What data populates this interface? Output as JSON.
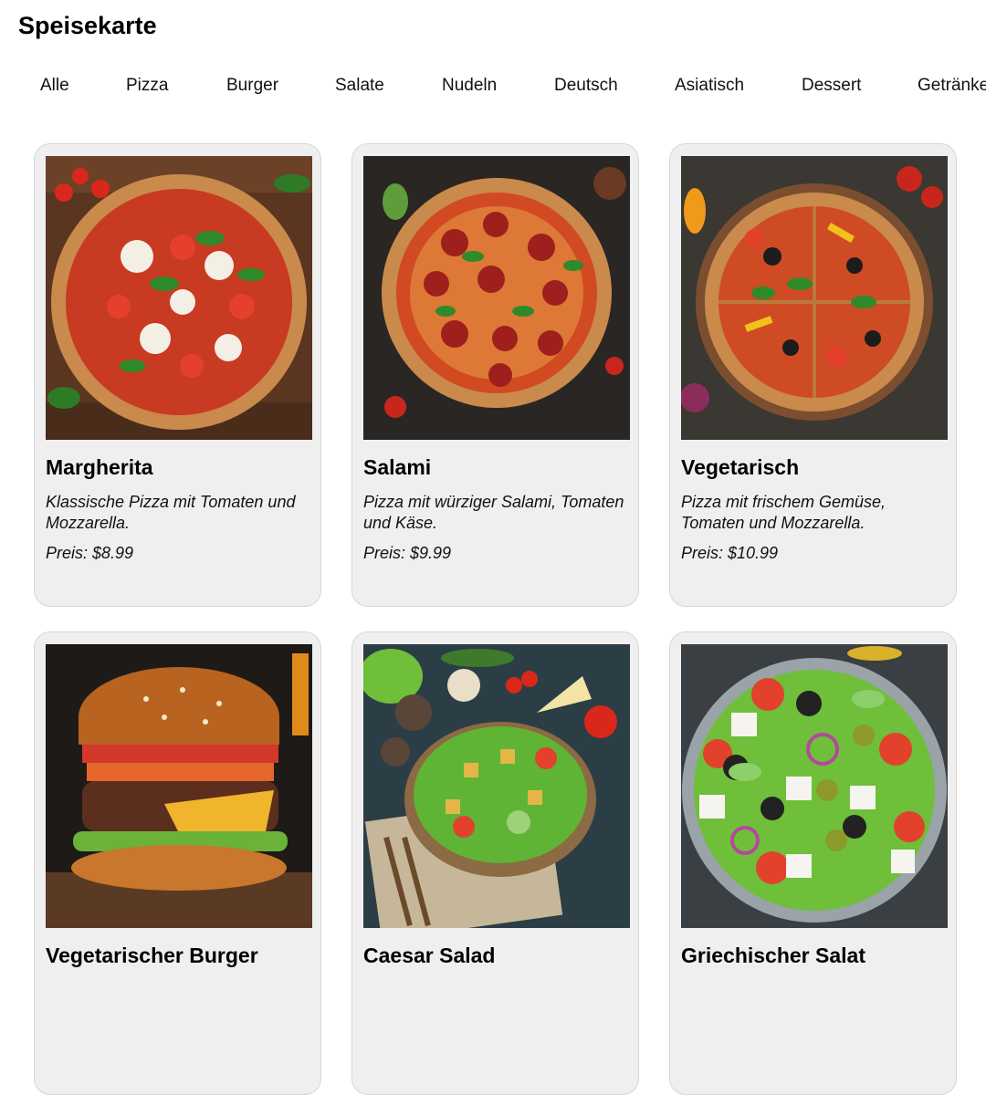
{
  "page": {
    "title": "Speisekarte"
  },
  "nav": {
    "items": [
      "Alle",
      "Pizza",
      "Burger",
      "Salate",
      "Nudeln",
      "Deutsch",
      "Asiatisch",
      "Dessert",
      "Getränke"
    ]
  },
  "menu": {
    "items": [
      {
        "name": "Margherita",
        "description": "Klassische Pizza mit Tomaten und Mozzarella.",
        "price": "Preis: $8.99",
        "image": "margherita-pizza-image"
      },
      {
        "name": "Salami",
        "description": "Pizza mit würziger Salami, Tomaten und Käse.",
        "price": "Preis: $9.99",
        "image": "salami-pizza-image"
      },
      {
        "name": "Vegetarisch",
        "description": "Pizza mit frischem Gemüse, Tomaten und Mozzarella.",
        "price": "Preis: $10.99",
        "image": "vegetarian-pizza-image"
      },
      {
        "name": "Vegetarischer Burger",
        "description": "",
        "price": "",
        "image": "veggie-burger-image"
      },
      {
        "name": "Caesar Salad",
        "description": "",
        "price": "",
        "image": "caesar-salad-image"
      },
      {
        "name": "Griechischer Salat",
        "description": "",
        "price": "",
        "image": "greek-salad-image"
      }
    ]
  }
}
